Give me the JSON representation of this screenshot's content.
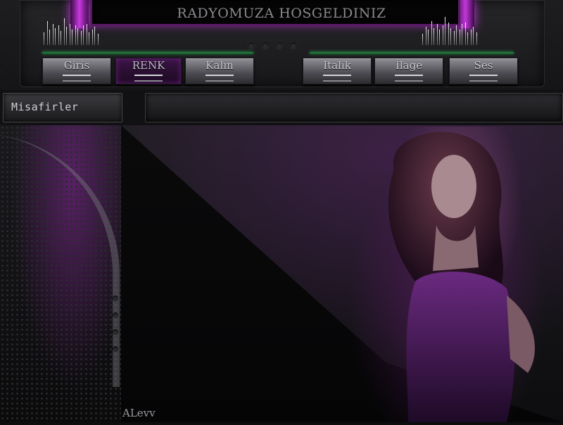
{
  "header": {
    "title": "RADYOMUZA HOSGELDINIZ"
  },
  "nav": {
    "items": [
      {
        "id": "giris",
        "label": "Giris"
      },
      {
        "id": "renk",
        "label": "RENK"
      },
      {
        "id": "kalin",
        "label": "Kalın"
      },
      {
        "id": "italik",
        "label": "Italik"
      },
      {
        "id": "ilage",
        "label": "İlage"
      },
      {
        "id": "ses",
        "label": "Ses"
      }
    ]
  },
  "sidebar": {
    "visitors_label": "Misafirler"
  },
  "footer": {
    "signature": "ALevv"
  },
  "colors": {
    "accent": "#c83ae0",
    "background": "#0d0d0f",
    "button": "#6a6a70"
  }
}
